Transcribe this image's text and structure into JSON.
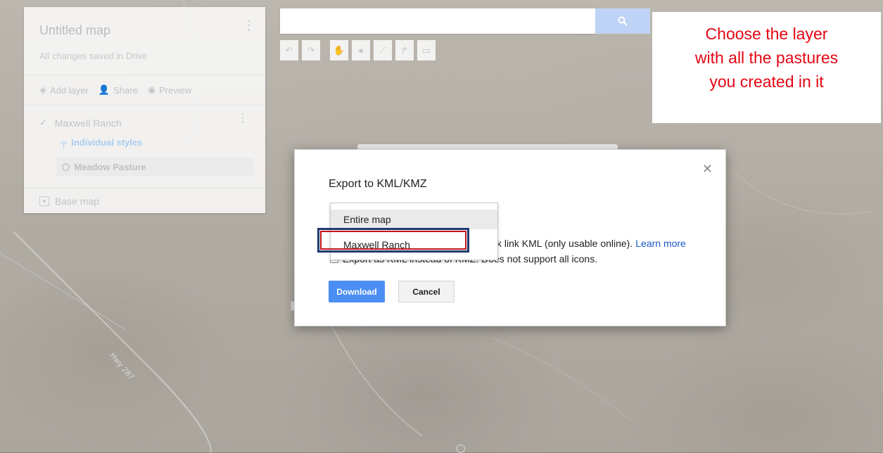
{
  "map": {
    "title": "Untitled map",
    "saved_status": "All changes saved in Drive",
    "actions": {
      "add_layer": "Add layer",
      "share": "Share",
      "preview": "Preview"
    },
    "layer": {
      "name": "Maxwell Ranch",
      "styles_label": "Individual styles",
      "feature": "Meadow Pasture"
    },
    "base_map": "Base map",
    "road_label": "Hwy 287"
  },
  "search": {
    "placeholder": ""
  },
  "callout": {
    "line1": "Choose the layer",
    "line2": "with all the pastures",
    "line3": "you created in it",
    "color": "#e30613"
  },
  "dialog": {
    "title": "Export to KML/KMZ",
    "dropdown_options": [
      "Entire map",
      "Maxwell Ranch"
    ],
    "selected_option": "Maxwell Ranch",
    "option1_tail": "k link KML (only usable online).",
    "learn_more": "Learn more",
    "option2_tail": "Export as KML instead of KMZ. Does not support all icons.",
    "option2_visible": "Does not support all icons.",
    "download": "Download",
    "cancel": "Cancel"
  },
  "colors": {
    "primary_button": "#4b8ef4",
    "highlight_border": "#1f3a6e",
    "highlight_inner": "#c0141a"
  }
}
